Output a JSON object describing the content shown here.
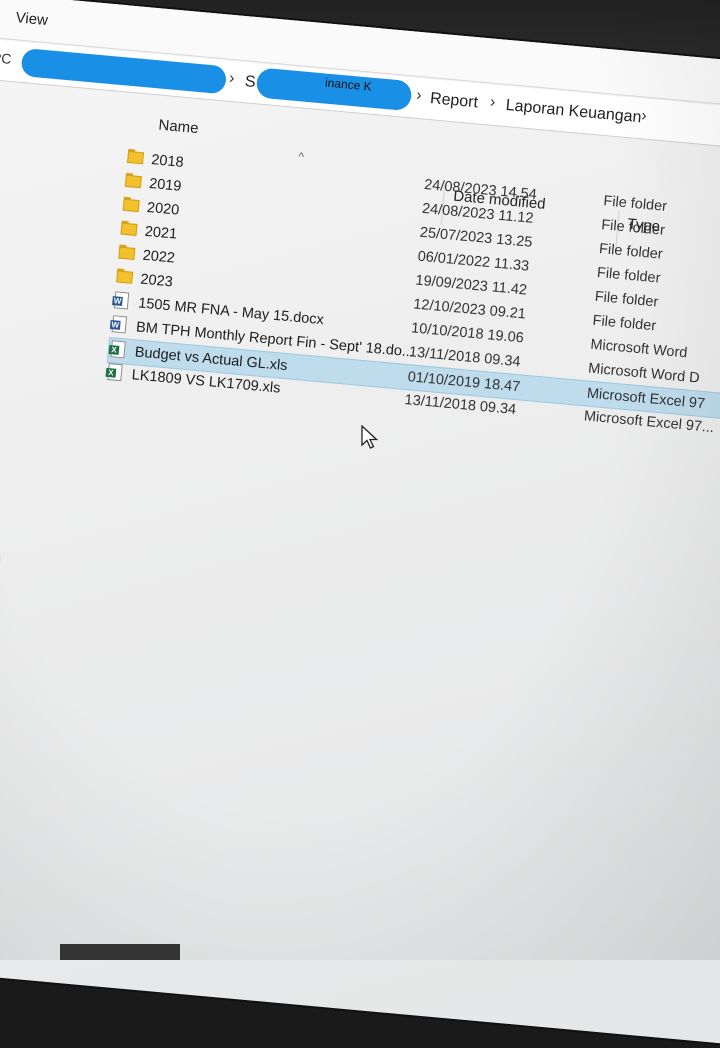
{
  "menubar": {
    "view_label": "View"
  },
  "address": {
    "pc_label": "PC",
    "visible_partial": "S",
    "partial_text": "inance K",
    "crumbs": [
      "Report",
      "Laporan Keuangan"
    ],
    "separator": "›",
    "redact_color": "#1a8fe6"
  },
  "columns": {
    "name": "Name",
    "date_modified": "Date modified",
    "type": "Type",
    "sort_indicator": "^"
  },
  "files": [
    {
      "name": "2018",
      "icon": "folder-icon",
      "date": "24/08/2023 14.54",
      "type": "File folder"
    },
    {
      "name": "2019",
      "icon": "folder-icon",
      "date": "24/08/2023 11.12",
      "type": "File folder"
    },
    {
      "name": "2020",
      "icon": "folder-icon",
      "date": "25/07/2023 13.25",
      "type": "File folder"
    },
    {
      "name": "2021",
      "icon": "folder-icon",
      "date": "06/01/2022 11.33",
      "type": "File folder"
    },
    {
      "name": "2022",
      "icon": "folder-icon",
      "date": "19/09/2023 11.42",
      "type": "File folder"
    },
    {
      "name": "2023",
      "icon": "folder-icon",
      "date": "12/10/2023 09.21",
      "type": "File folder"
    },
    {
      "name": "1505 MR FNA - May 15.docx",
      "icon": "word-doc-icon",
      "date": "10/10/2018 19.06",
      "type": "Microsoft Word"
    },
    {
      "name": "BM TPH Monthly Report Fin - Sept' 18.do...",
      "icon": "word-doc-icon",
      "date": "13/11/2018 09.34",
      "type": "Microsoft Word D"
    },
    {
      "name": "Budget vs Actual GL.xls",
      "icon": "excel-sheet-icon",
      "date": "01/10/2019 18.47",
      "type": "Microsoft Excel 97",
      "selected": true
    },
    {
      "name": "LK1809 VS LK1709.xls",
      "icon": "excel-sheet-icon",
      "date": "13/11/2018 09.34",
      "type": "Microsoft Excel 97..."
    }
  ],
  "colors": {
    "selection": "#bfdcec",
    "folder": "#f2c12e",
    "word": "#2b5797",
    "excel": "#1e7145"
  }
}
